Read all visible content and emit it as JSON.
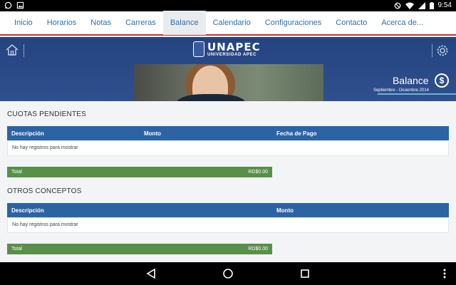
{
  "status_bar": {
    "time": "9:54",
    "left_icons": [
      "whatsapp-icon",
      "gallery-icon"
    ],
    "right_icons": [
      "do-not-disturb-icon",
      "wifi-icon",
      "signal-icon",
      "battery-icon"
    ]
  },
  "nav": {
    "tabs": [
      "Inicio",
      "Horarios",
      "Notas",
      "Carreras",
      "Balance",
      "Calendario",
      "Configuraciones",
      "Contacto",
      "Acerca de..."
    ],
    "active_tab": "Balance"
  },
  "header": {
    "logo_brand": "UNAPEC",
    "logo_sub": "UNIVERSIDAD APEC",
    "page_title": "Balance",
    "period": "Septiembre - Diciembre 2014",
    "accent_color": "#2c4a85"
  },
  "cuotas": {
    "title": "CUOTAS PENDIENTES",
    "columns": [
      "Descripción",
      "Monto",
      "Fecha de Pago"
    ],
    "empty_message": "No hay registros para mostrar",
    "total_label": "Total",
    "total_value": "RD$0.00"
  },
  "otros": {
    "title": "OTROS CONCEPTOS",
    "columns": [
      "Descripción",
      "Monto"
    ],
    "empty_message": "No hay registros para mostrar",
    "total_label": "Total",
    "total_value": "RD$0.00"
  },
  "colors": {
    "table_header": "#2c63a4",
    "total_bar": "#58904a",
    "nav_underline": "#c0392b"
  }
}
